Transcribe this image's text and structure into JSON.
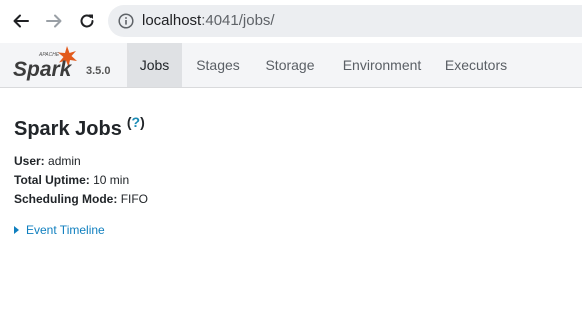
{
  "browser": {
    "url_host": "localhost",
    "url_rest": ":4041/jobs/"
  },
  "nav": {
    "logo_text": "Spark",
    "logo_small": "APACHE",
    "version": "3.5.0",
    "tabs": [
      {
        "label": "Jobs",
        "active": true
      },
      {
        "label": "Stages",
        "active": false
      },
      {
        "label": "Storage",
        "active": false
      },
      {
        "label": "Environment",
        "active": false
      },
      {
        "label": "Executors",
        "active": false
      }
    ]
  },
  "page": {
    "title": "Spark Jobs",
    "help": "?",
    "help_open": "(",
    "help_close": ")",
    "user_label": "User:",
    "user_value": "admin",
    "uptime_label": "Total Uptime:",
    "uptime_value": "10 min",
    "mode_label": "Scheduling Mode:",
    "mode_value": "FIFO",
    "timeline_label": "Event Timeline"
  },
  "colors": {
    "link": "#0f7fbf",
    "help": "#1a8bb5",
    "logo_star": "#e25a1c"
  }
}
